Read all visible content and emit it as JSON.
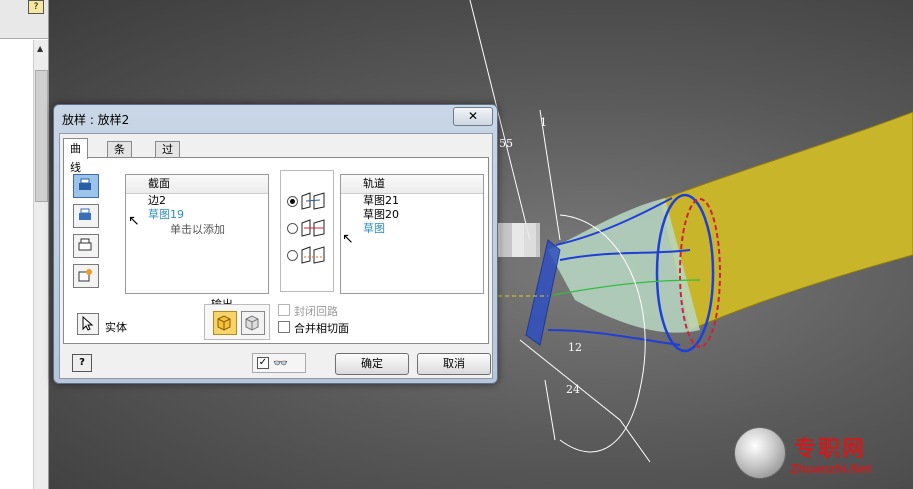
{
  "dialog": {
    "title": "放样 : 放样2",
    "close_glyph": "✕",
    "tabs": [
      {
        "label": "曲线"
      },
      {
        "label": "条件"
      },
      {
        "label": "过渡"
      }
    ],
    "sections": {
      "header": "截面",
      "items": [
        "边2",
        "草图19"
      ],
      "hint": "单击以添加"
    },
    "rails": {
      "header": "轨道",
      "items": [
        "草图21",
        "草图20",
        "草图"
      ]
    },
    "output": {
      "label": "输出",
      "entity_label": "实体"
    },
    "checkboxes": {
      "closed_loop": "封闭回路",
      "merge_tangent": "合并相切面"
    },
    "footer": {
      "help": "?",
      "preview_check": "✓",
      "ok": "确定",
      "cancel": "取消"
    }
  },
  "viewport": {
    "dimensions": [
      "55",
      "1",
      "12",
      "24"
    ],
    "watermark_cn": "专职网",
    "watermark_en": "Zhuanzhi.Net"
  },
  "colors": {
    "accent_red": "#c81e1e",
    "list_blue": "#2a8fb8",
    "model_yellow": "#c9b52a",
    "sketch_blue": "#1f3fd6"
  }
}
